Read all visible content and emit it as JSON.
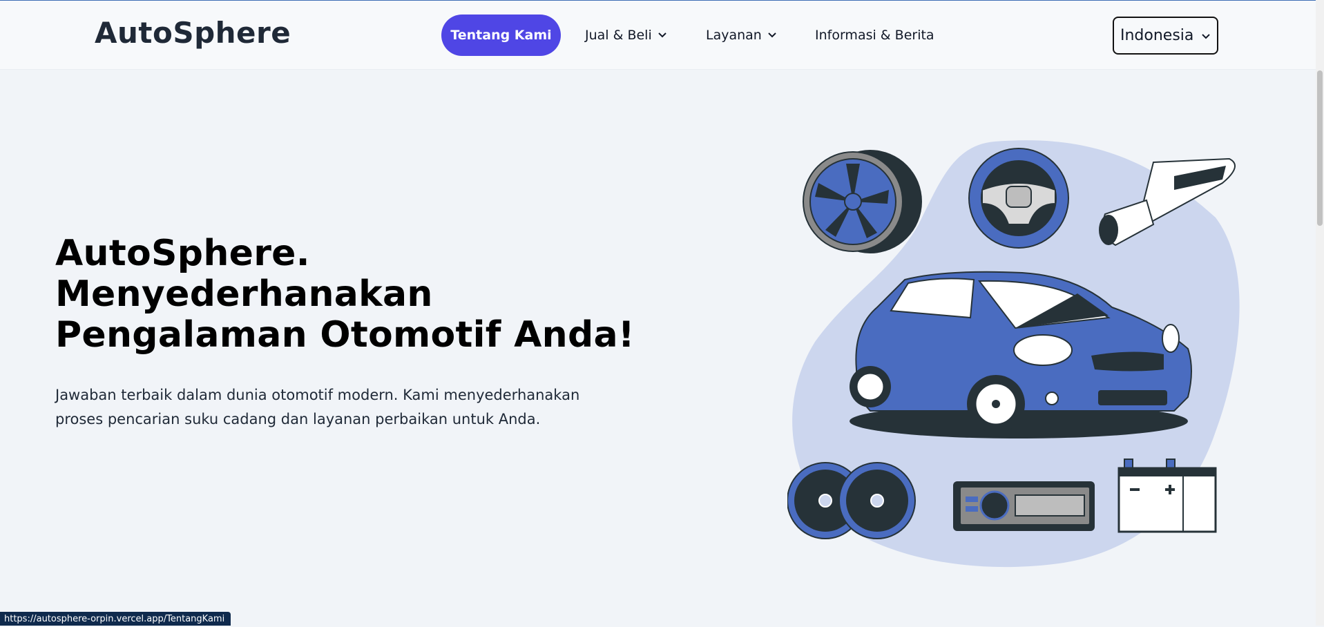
{
  "navbar": {
    "logo": "AutoSphere",
    "items": [
      {
        "label": "Tentang Kami",
        "active": true
      },
      {
        "label": "Jual & Beli",
        "has_dropdown": true
      },
      {
        "label": "Layanan",
        "has_dropdown": true
      },
      {
        "label": "Informasi & Berita"
      }
    ],
    "language": "Indonesia"
  },
  "hero": {
    "title_lines": [
      "AutoSphere.",
      "Menyederhanakan",
      "Pengalaman Otomotif Anda!"
    ],
    "description": "Jawaban terbaik dalam dunia otomotif modern. Kami menyederhanakan proses pencarian suku cadang dan layanan perbaikan untuk Anda."
  },
  "status_bar": {
    "url": "https://autosphere-orpin.vercel.app/TentangKami"
  },
  "colors": {
    "accent": "#4f46e5",
    "illustration_blue": "#4a6cc0",
    "illustration_blob": "#ccd6ee",
    "dark": "#263238",
    "page_bg": "#f1f4f8"
  },
  "icons": [
    "chevron-down-icon",
    "tire-icon",
    "steering-wheel-icon",
    "exhaust-icon",
    "car-icon",
    "speaker-icon",
    "car-radio-icon",
    "battery-icon"
  ]
}
